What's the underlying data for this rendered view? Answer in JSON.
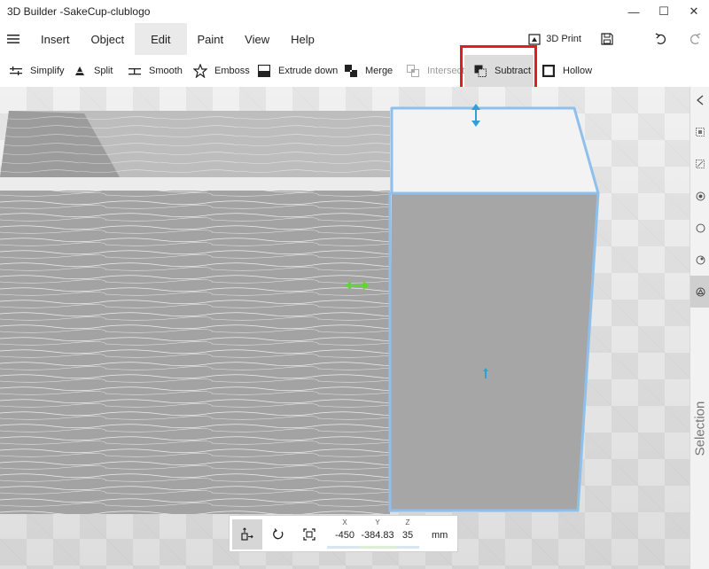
{
  "window": {
    "title": "3D Builder -SakeCup-clublogo",
    "minimize": "—",
    "maximize": "☐",
    "close": "✕"
  },
  "menu": {
    "hamburger_icon": "hamburger-icon",
    "items": [
      "Insert",
      "Object",
      "Edit",
      "Paint",
      "View",
      "Help"
    ],
    "active": "Edit",
    "print_label": "3D Print"
  },
  "toolbar": {
    "tools": [
      {
        "label": "Simplify",
        "icon": "simplify-icon"
      },
      {
        "label": "Split",
        "icon": "split-icon"
      },
      {
        "label": "Smooth",
        "icon": "smooth-icon"
      },
      {
        "label": "Emboss",
        "icon": "emboss-icon"
      },
      {
        "label": "Extrude down",
        "icon": "extrude-down-icon"
      },
      {
        "label": "Merge",
        "icon": "merge-icon"
      },
      {
        "label": "Intersect",
        "icon": "intersect-icon",
        "disabled": true
      },
      {
        "label": "Subtract",
        "icon": "subtract-icon",
        "highlighted": true
      },
      {
        "label": "Hollow",
        "icon": "hollow-icon"
      }
    ]
  },
  "sidebar": {
    "label": "Selection"
  },
  "transform": {
    "x_label": "X",
    "x_value": "-450",
    "y_label": "Y",
    "y_value": "-384.83",
    "z_label": "Z",
    "z_value": "35",
    "unit": "mm"
  },
  "colors": {
    "highlight": "#e01e1e",
    "selection_outline": "#8fc0ec",
    "gizmo_blue": "#2f9fd6",
    "gizmo_green": "#5ed63a",
    "model_gray": "#a3a3a3"
  }
}
